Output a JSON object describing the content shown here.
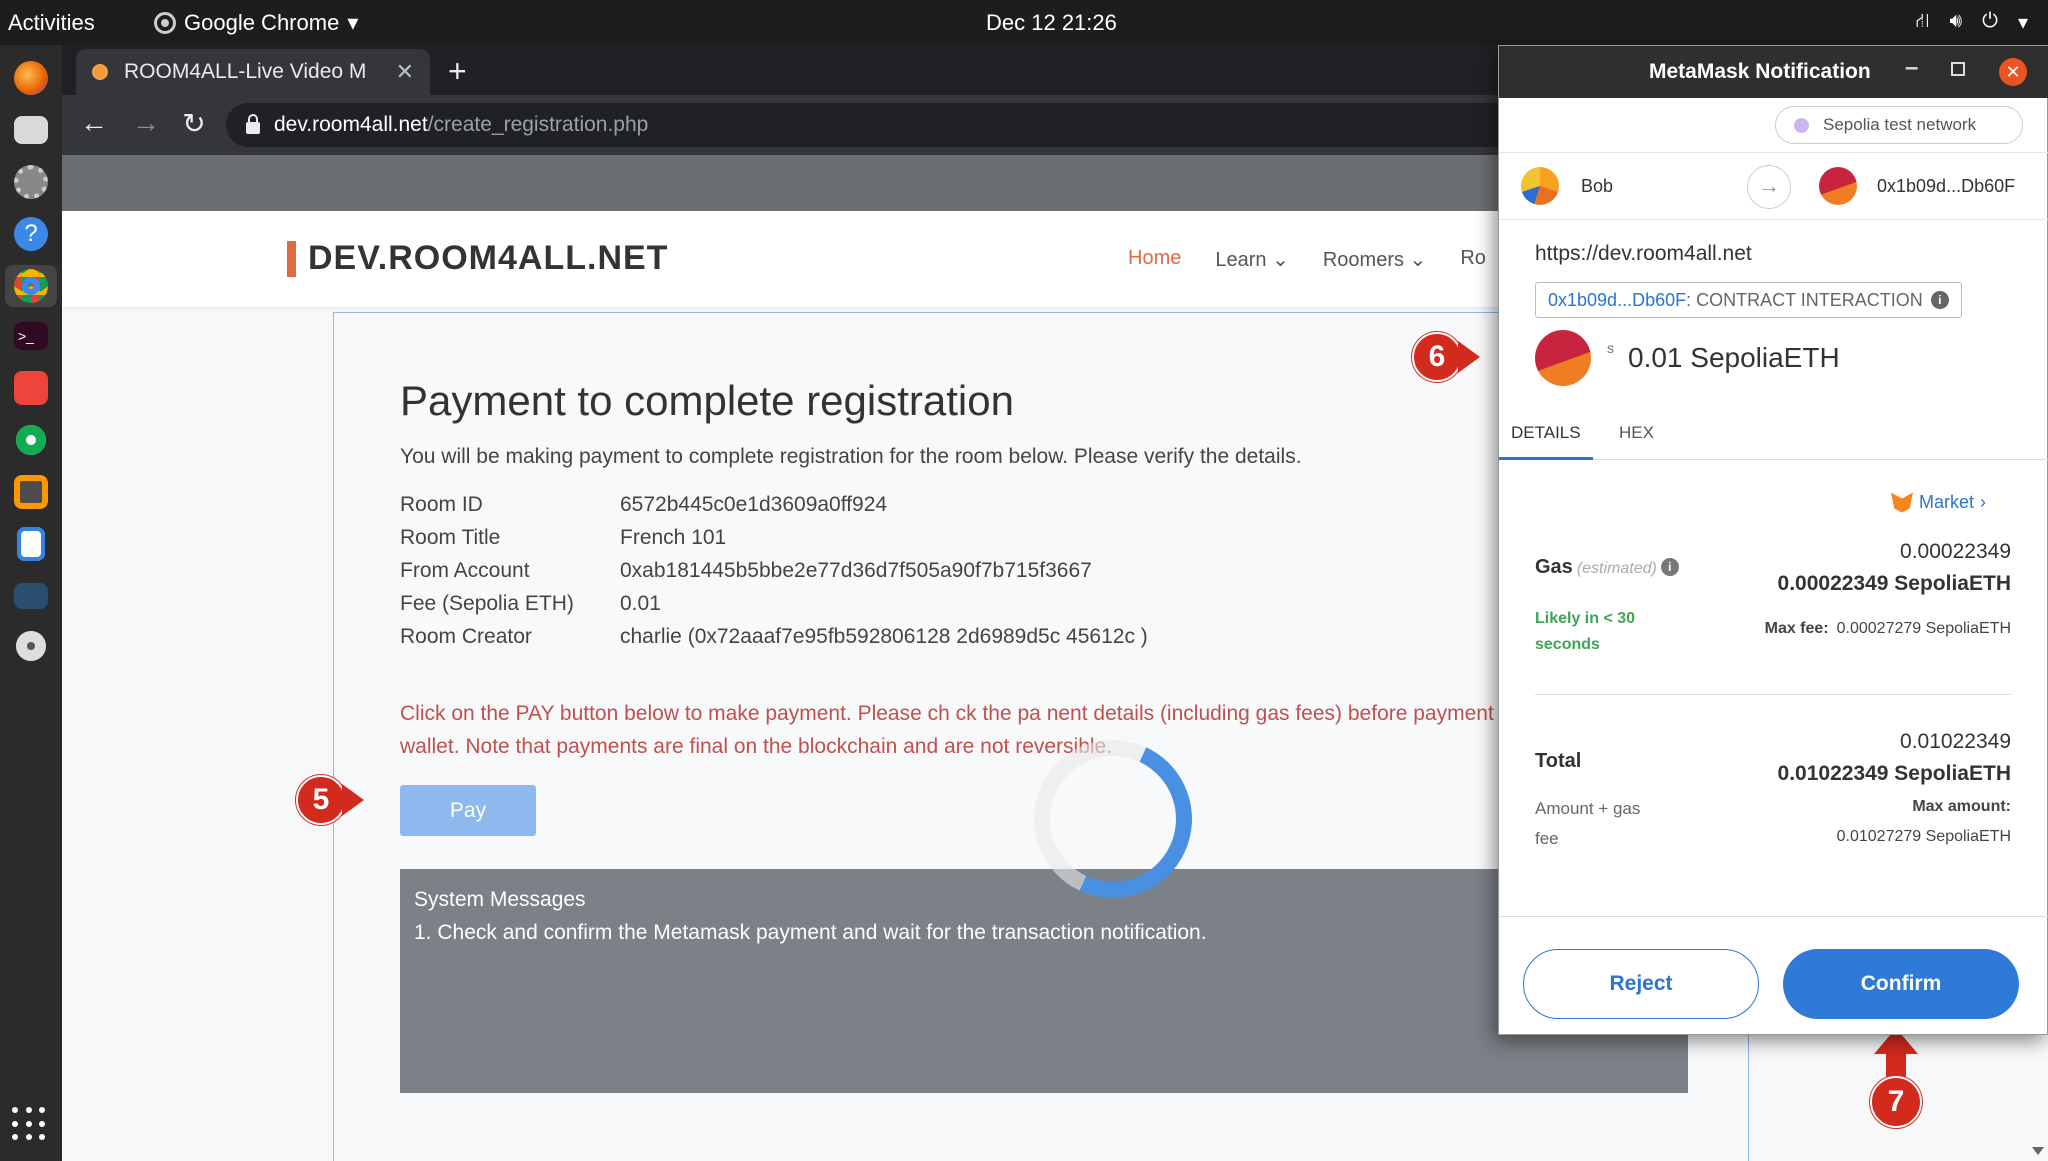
{
  "topbar": {
    "activities": "Activities",
    "app": "Google Chrome",
    "clock": "Dec 12  21:26"
  },
  "browser": {
    "tab_title": "ROOM4ALL-Live Video M",
    "url_host": "dev.room4all.net",
    "url_path": "/create_registration.php"
  },
  "site": {
    "logo": "DEV.ROOM4ALL.NET",
    "menu": [
      "Home",
      "Learn",
      "Roomers",
      "Ro"
    ]
  },
  "card": {
    "title": "Payment to complete registration",
    "intro": "You will be making payment to complete registration for the room below. Please verify the details.",
    "rows": [
      {
        "k": "Room ID",
        "v": "6572b445c0e1d3609a0ff924"
      },
      {
        "k": "Room Title",
        "v": "French 101"
      },
      {
        "k": "From Account",
        "v": "0xab181445b5bbe2e77d36d7f505a90f7b715f3667"
      },
      {
        "k": "Fee (Sepolia ETH)",
        "v": "0.01"
      },
      {
        "k": "Room Creator",
        "v": "charlie (0x72aaaf7e95fb592806128 2d6989d5c 45612c )"
      }
    ],
    "warning": "Click on the PAY button below to make payment. Please ch ck the pa nent details (including gas fees) before payment on your wallet. Note that payments are final on the blockchain and are not reversible.",
    "pay_label": "Pay",
    "sys_title": "System Messages",
    "sys_msg": "1. Check and confirm the Metamask payment and wait for the transaction notification."
  },
  "steps": {
    "s5": "5",
    "s6": "6",
    "s7": "7"
  },
  "metamask": {
    "title": "MetaMask Notification",
    "network": "Sepolia test network",
    "from_name": "Bob",
    "to_addr": "0x1b09d...Db60F",
    "origin": "https://dev.room4all.net",
    "contract_addr": "0x1b09d...Db60F",
    "contract_label": " : CONTRACT INTERACTION",
    "currency_symbol": "s",
    "amount": "0.01 SepoliaETH",
    "tab_details": "DETAILS",
    "tab_hex": "HEX",
    "market": "Market",
    "gas_label": "Gas",
    "gas_est": "(estimated)",
    "gas_v1": "0.00022349",
    "gas_v2": "0.00022349 SepoliaETH",
    "likely": "Likely in < 30 seconds",
    "maxfee_label": "Max fee:",
    "maxfee_val": "0.00027279 SepoliaETH",
    "total_label": "Total",
    "total_v1": "0.01022349",
    "total_v2": "0.01022349 SepoliaETH",
    "amount_gas": "Amount + gas fee",
    "maxamt_label": "Max amount:",
    "maxamt_val": "0.01027279 SepoliaETH",
    "reject": "Reject",
    "confirm": "Confirm"
  },
  "colors": {
    "accent": "#e06a43",
    "metamask_blue": "#2f7ad6",
    "warning_red": "#c0504d",
    "step_red": "#d32a1e"
  }
}
